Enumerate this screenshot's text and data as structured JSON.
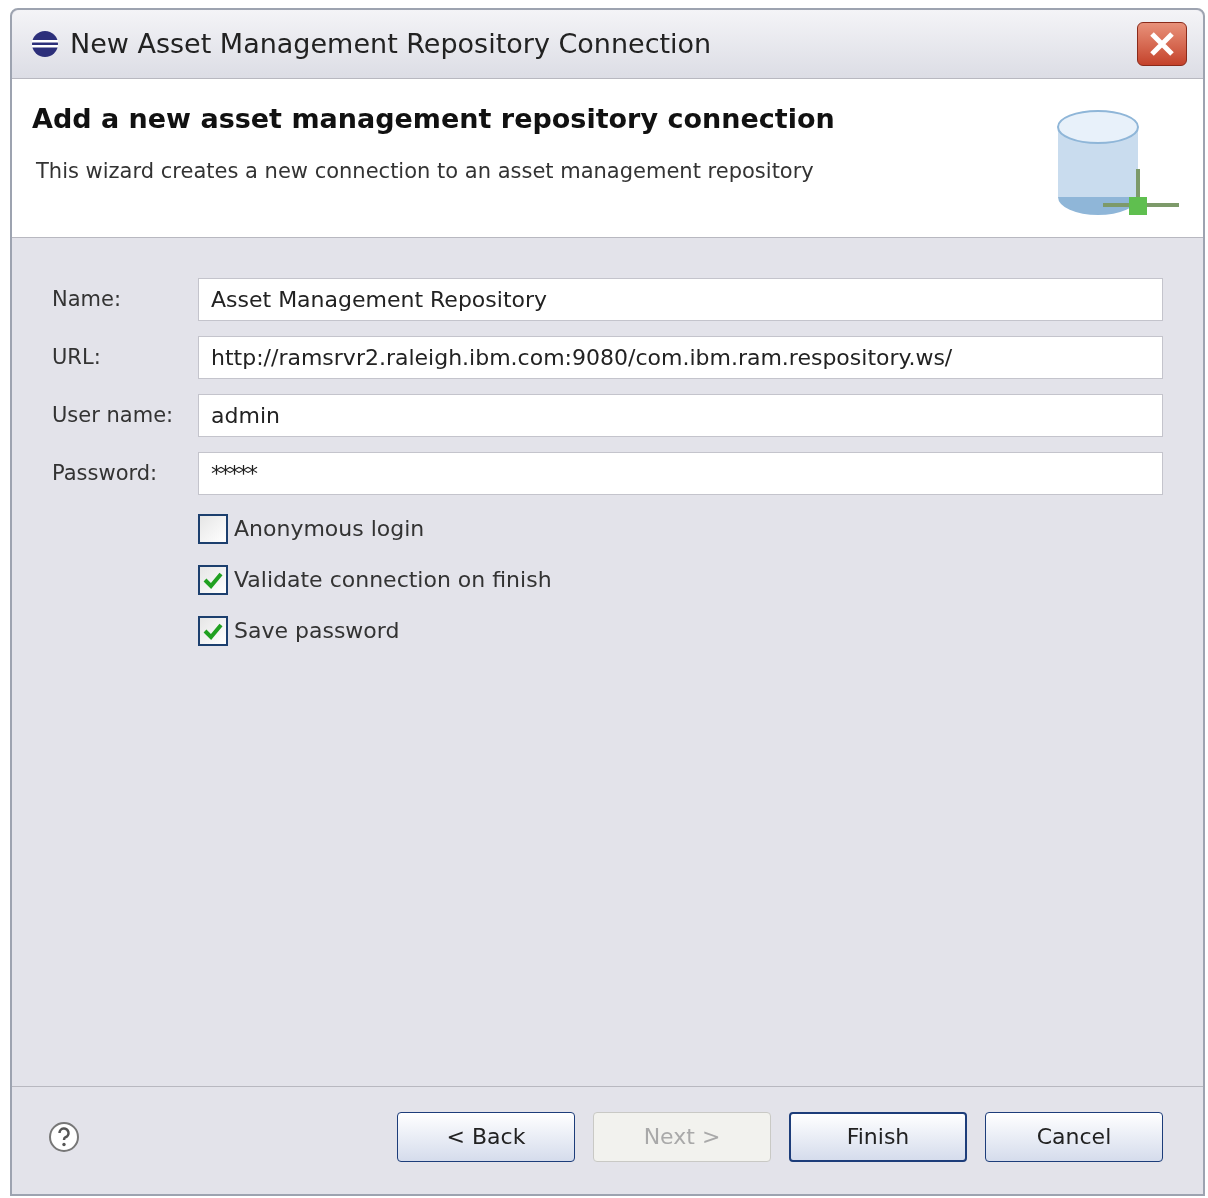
{
  "window": {
    "title": "New Asset Management Repository Connection"
  },
  "header": {
    "title": "Add a new asset management repository connection",
    "description": "This wizard creates a new connection to an asset management repository"
  },
  "fields": [
    {
      "label": "Name:",
      "value": "Asset Management Repository",
      "kind": "text"
    },
    {
      "label": "URL:",
      "value": "http://ramsrvr2.raleigh.ibm.com:9080/com.ibm.ram.respository.ws/",
      "kind": "text"
    },
    {
      "label": "User name:",
      "value": "admin",
      "kind": "text"
    },
    {
      "label": "Password:",
      "value": "*****",
      "kind": "password"
    }
  ],
  "checkboxes": [
    {
      "label": "Anonymous login",
      "checked": false
    },
    {
      "label": "Validate connection on finish",
      "checked": true
    },
    {
      "label": "Save password",
      "checked": true
    }
  ],
  "buttons": [
    {
      "label": "< Back",
      "disabled": false,
      "default": false
    },
    {
      "label": "Next >",
      "disabled": true,
      "default": false
    },
    {
      "label": "Finish",
      "disabled": false,
      "default": true
    },
    {
      "label": "Cancel",
      "disabled": false,
      "default": false
    }
  ]
}
